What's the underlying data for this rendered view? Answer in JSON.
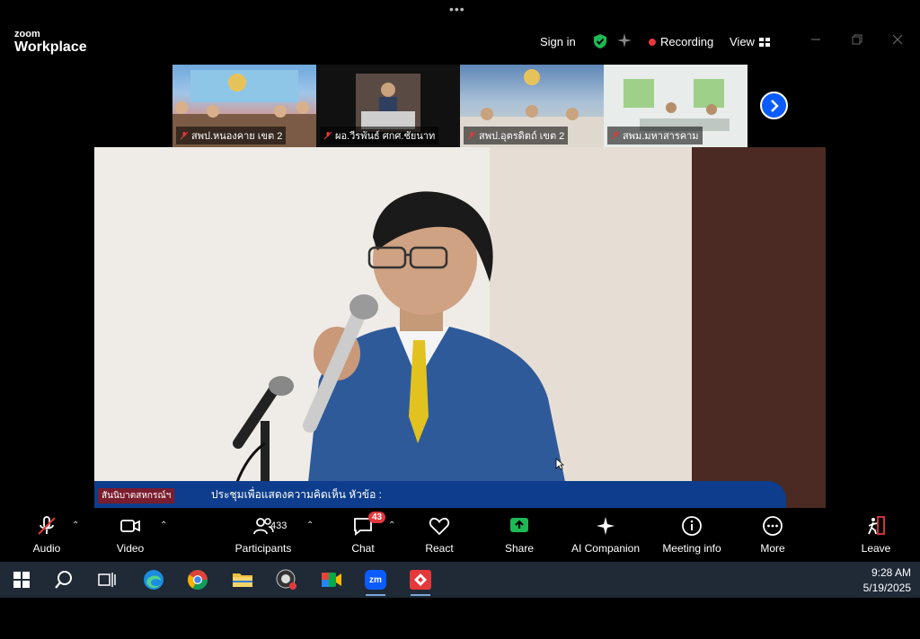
{
  "titlebar": {
    "more_dots": "•••",
    "logo_small": "zoom",
    "logo_big": "Workplace",
    "signin_label": "Sign in",
    "recording_label": "Recording",
    "view_label": "View"
  },
  "thumbnails": [
    {
      "label": "สพป.หนองคาย เขต 2"
    },
    {
      "label": "ผอ.วีรพันธ์ ศกศ.ชัยนาท"
    },
    {
      "label": "สพป.อุตรดิตถ์ เขต 2"
    },
    {
      "label": "สพม.มหาสารคาม"
    }
  ],
  "video": {
    "banner_tag": "สันนิบาตสหกรณ์ฯ",
    "banner_text": "ประชุมเพื่อแสดงความคิดเห็น หัวข้อ :"
  },
  "toolbar": {
    "audio": "Audio",
    "video": "Video",
    "participants": "Participants",
    "participants_count": "433",
    "chat": "Chat",
    "chat_badge": "43",
    "react": "React",
    "share": "Share",
    "ai_companion": "AI Companion",
    "meeting_info": "Meeting info",
    "more": "More",
    "leave": "Leave"
  },
  "taskbar": {
    "time": "9:28 AM",
    "date": "5/19/2025",
    "zoom_icon_text": "zm"
  },
  "colors": {
    "accent_blue": "#0b5cff",
    "share_green": "#1db954",
    "record_red": "#e5383b"
  }
}
